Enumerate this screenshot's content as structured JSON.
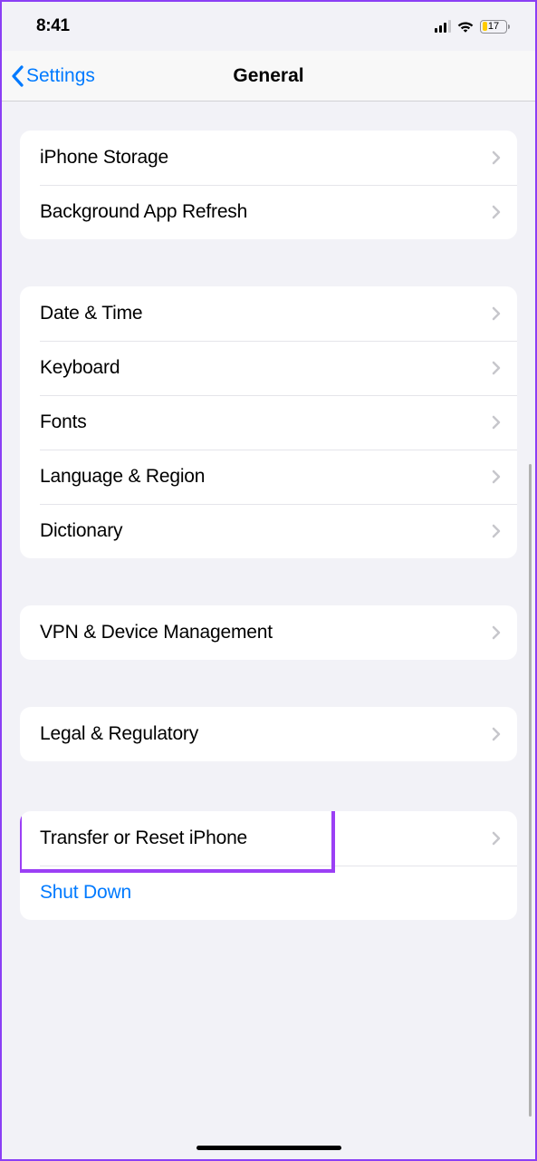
{
  "statusBar": {
    "time": "8:41",
    "batteryPercent": "17"
  },
  "nav": {
    "back": "Settings",
    "title": "General"
  },
  "groups": {
    "g1": {
      "iphoneStorage": "iPhone Storage",
      "bgAppRefresh": "Background App Refresh"
    },
    "g2": {
      "dateTime": "Date & Time",
      "keyboard": "Keyboard",
      "fonts": "Fonts",
      "langRegion": "Language & Region",
      "dictionary": "Dictionary"
    },
    "g3": {
      "vpn": "VPN & Device Management"
    },
    "g4": {
      "legal": "Legal & Regulatory"
    },
    "g5": {
      "transferReset": "Transfer or Reset iPhone",
      "shutDown": "Shut Down"
    }
  }
}
